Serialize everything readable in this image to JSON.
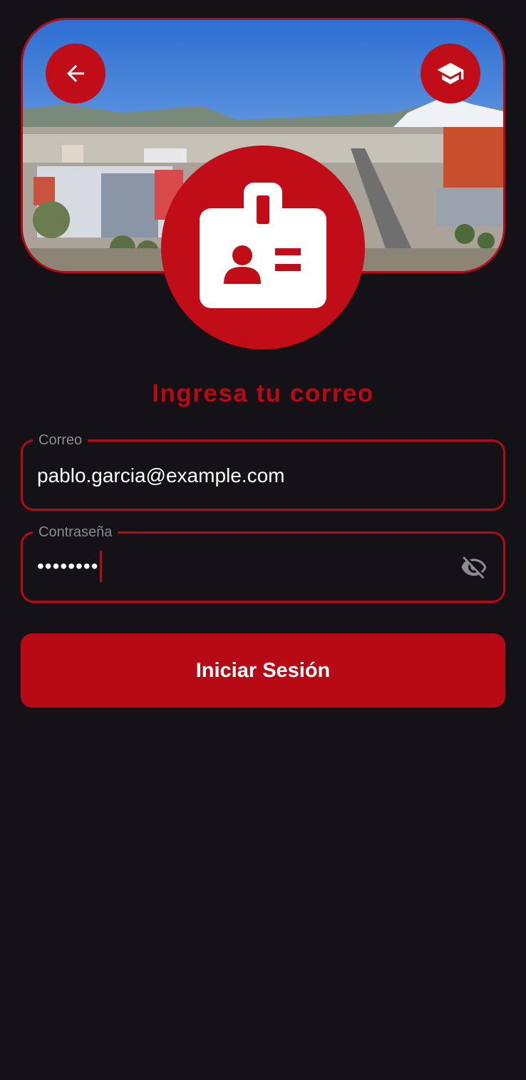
{
  "header": {
    "back_icon": "arrow-left-icon",
    "graduation_icon": "graduation-cap-icon",
    "banner_image": "campus-cityscape-with-volcano",
    "badge_icon": "id-badge-icon"
  },
  "form": {
    "title": "Ingresa tu correo",
    "email": {
      "label": "Correo",
      "value": "pablo.garcia@example.com"
    },
    "password": {
      "label": "Contraseña",
      "masked_value": "••••••••",
      "visibility_icon": "eye-slash-icon"
    },
    "submit_label": "Iniciar Sesión"
  },
  "colors": {
    "accent": "#b80a15",
    "background": "#141217",
    "text": "#ffffff",
    "label": "#8e8a90"
  }
}
